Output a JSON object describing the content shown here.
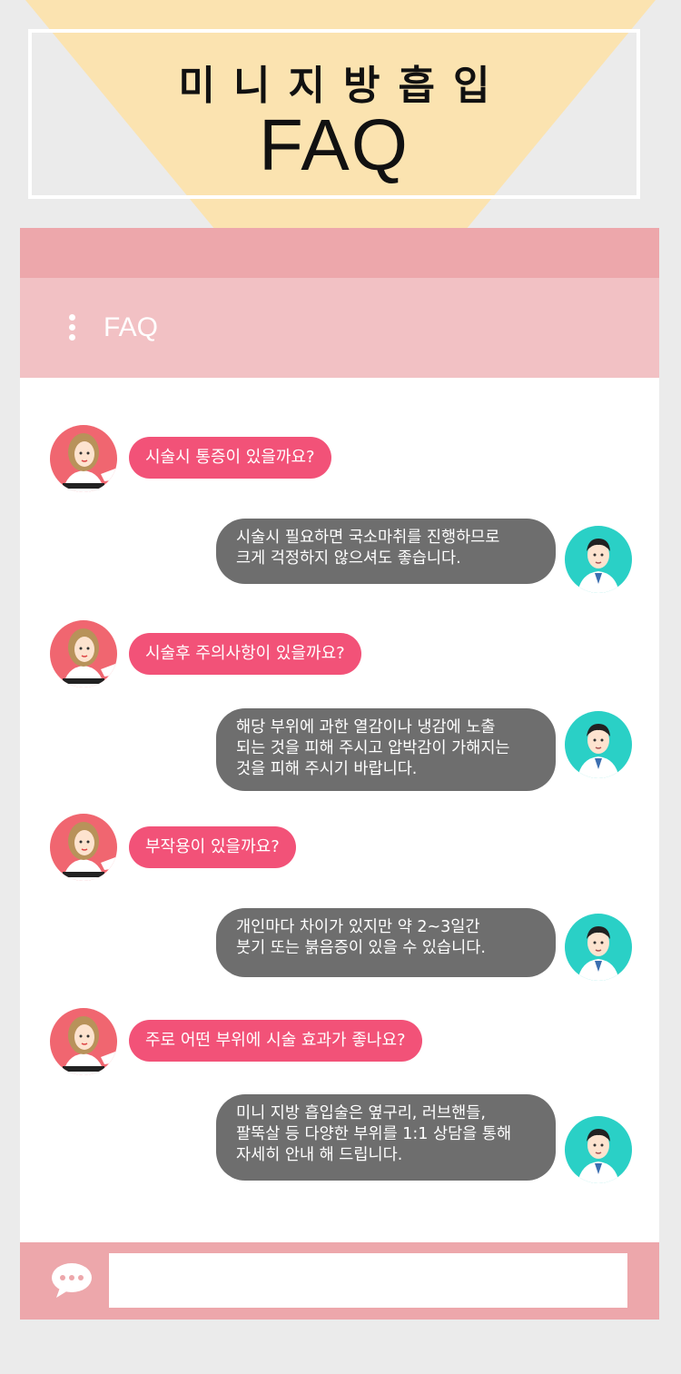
{
  "page": {
    "title_ko": "미니지방흡입",
    "title_en": "FAQ"
  },
  "chat": {
    "header_title": "FAQ",
    "menu_icon": "vertical-dots-icon",
    "faq": [
      {
        "question": "시술시 통증이 있을까요?",
        "answer": "시술시 필요하면 국소마취를 진행하므로\n크게 걱정하지 않으셔도 좋습니다."
      },
      {
        "question": "시술후 주의사항이 있을까요?",
        "answer": "해당 부위에 과한 열감이나 냉감에 노출\n되는 것을 피해 주시고 압박감이 가해지는\n것을 피해 주시기 바랍니다."
      },
      {
        "question": "부작용이 있을까요?",
        "answer": "개인마다 차이가 있지만 약 2~3일간\n붓기 또는 붉음증이 있을 수 있습니다."
      },
      {
        "question": "주로 어떤 부위에 시술 효과가 좋나요?",
        "answer": "미니 지방 흡입술은 옆구리, 러브핸들,\n팔뚝살 등 다양한 부위를 1:1 상담을 통해\n자세히 안내 해 드립니다."
      }
    ],
    "input": {
      "value": "",
      "icon": "speech-bubble-icon"
    }
  },
  "colors": {
    "question_bubble": "#f25278",
    "answer_bubble": "#6e6e6e",
    "header": "#f2c1c4",
    "strip": "#eda7ab",
    "beam": "#fbe3b0",
    "patient_avatar_bg": "#f06670",
    "doctor_avatar_bg": "#2ad0c6"
  }
}
